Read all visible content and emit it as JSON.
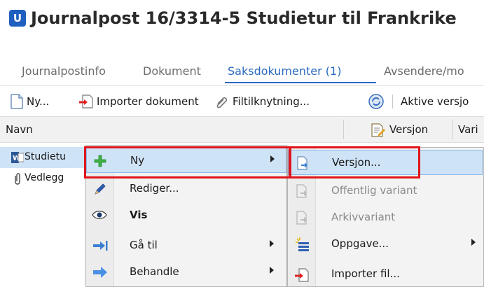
{
  "window": {
    "logo_letter": "U",
    "title": "Journalpost 16/3314-5 Studietur til Frankrike"
  },
  "tabs": [
    {
      "label": "Journalpostinfo",
      "active": false
    },
    {
      "label": "Dokument",
      "active": false
    },
    {
      "label": "Saksdokumenter (1)",
      "active": true
    },
    {
      "label": "Avsendere/mo",
      "active": false
    }
  ],
  "toolbar": {
    "new_label": "Ny...",
    "import_label": "Importer dokument",
    "filter_label": "Filtilknytning...",
    "active_versions_label": "Aktive versjo"
  },
  "grid": {
    "col_name": "Navn",
    "col_version": "Versjon",
    "col_variant": "Vari",
    "rows": [
      {
        "label": "Studietu",
        "icon": "word-document-icon",
        "selected": true
      },
      {
        "label": "Vedlegg",
        "icon": "paperclip-icon",
        "selected": false
      }
    ]
  },
  "context_menu": {
    "items": [
      {
        "label": "Ny",
        "icon": "plus-icon",
        "submenu": true,
        "bold": false,
        "highlighted": true
      },
      {
        "label": "Rediger...",
        "icon": "pencil-icon",
        "submenu": false,
        "bold": false,
        "highlighted": false
      },
      {
        "label": "Vis",
        "icon": "eye-icon",
        "submenu": false,
        "bold": true,
        "highlighted": false
      },
      {
        "label": "Gå til",
        "icon": "goto-arrow-icon",
        "submenu": true,
        "bold": false,
        "highlighted": false
      },
      {
        "label": "Behandle",
        "icon": "process-arrow-icon",
        "submenu": true,
        "bold": false,
        "highlighted": false
      }
    ]
  },
  "submenu": {
    "items": [
      {
        "label": "Versjon...",
        "icon": "new-version-icon",
        "disabled": false,
        "submenu": false,
        "highlighted": true
      },
      {
        "label": "Offentlig variant",
        "icon": "public-variant-icon",
        "disabled": true,
        "submenu": false,
        "highlighted": false
      },
      {
        "label": "Arkivvariant",
        "icon": "archive-variant-icon",
        "disabled": true,
        "submenu": false,
        "highlighted": false
      },
      {
        "label": "Oppgave...",
        "icon": "task-icon",
        "disabled": false,
        "submenu": true,
        "highlighted": false
      },
      {
        "label": "Importer fil...",
        "icon": "import-file-icon",
        "disabled": false,
        "submenu": false,
        "highlighted": false
      }
    ]
  },
  "colors": {
    "accent": "#2b6ac0",
    "highlight": "#cfe3f7",
    "callout": "#e0151b"
  }
}
